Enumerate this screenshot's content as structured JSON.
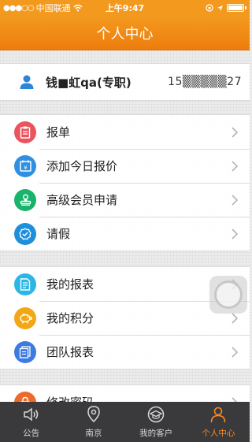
{
  "status": {
    "carrier": "中国联通",
    "time": "上午9:47"
  },
  "nav": {
    "title": "个人中心"
  },
  "profile": {
    "name": "钱■虹qa(专职)",
    "phone": "15▒▒▒▒▒27"
  },
  "menu_group_1": [
    {
      "label": "报单",
      "icon": "clipboard-icon",
      "color": "#e9545e"
    },
    {
      "label": "添加今日报价",
      "icon": "calendar-icon",
      "color": "#2f8fe0"
    },
    {
      "label": "高级会员申请",
      "icon": "stamp-icon",
      "color": "#19b36b"
    },
    {
      "label": "请假",
      "icon": "check-badge-icon",
      "color": "#1d8fdb"
    }
  ],
  "menu_group_2": [
    {
      "label": "我的报表",
      "icon": "report-icon",
      "color": "#2bb6e6"
    },
    {
      "label": "我的积分",
      "icon": "piggy-bank-icon",
      "color": "#f1a716"
    },
    {
      "label": "团队报表",
      "icon": "team-report-icon",
      "color": "#3c7be0"
    }
  ],
  "menu_group_3": [
    {
      "label": "修改密码",
      "icon": "lock-icon",
      "color": "#ee6a2c"
    }
  ],
  "tabs": [
    {
      "label": "公告",
      "icon": "speaker-icon",
      "active": false
    },
    {
      "label": "南京",
      "icon": "location-icon",
      "active": false
    },
    {
      "label": "我的客户",
      "icon": "customers-icon",
      "active": false
    },
    {
      "label": "个人中心",
      "icon": "person-icon",
      "active": true
    }
  ],
  "colors": {
    "accent": "#f39a1e",
    "tab_active": "#ff8a1f",
    "tab_bar": "#3a3a3c"
  }
}
